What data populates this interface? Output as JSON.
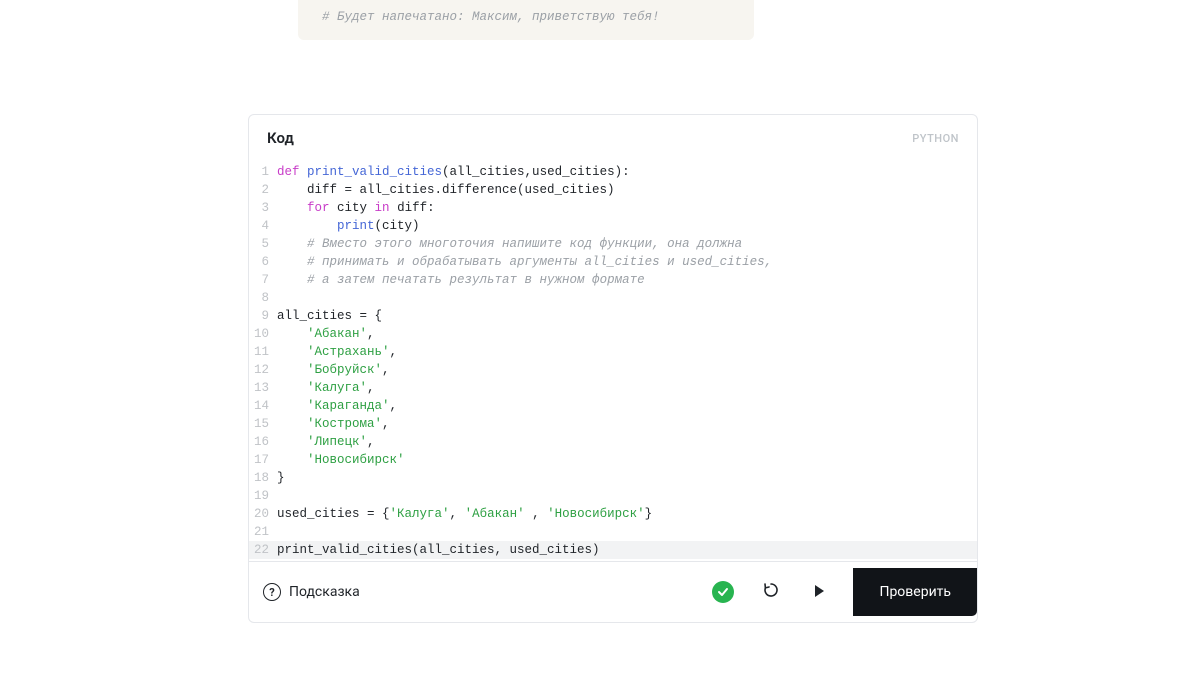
{
  "top_comment": "# Будет напечатано: Максим, приветствую тебя!",
  "editor": {
    "title": "Код",
    "language": "PYTHON",
    "lines": [
      {
        "n": 1,
        "hl": false,
        "tokens": [
          {
            "t": "def ",
            "c": "kw"
          },
          {
            "t": "print_valid_cities",
            "c": "fn"
          },
          {
            "t": "(all_cities,used_cities):",
            "c": ""
          }
        ]
      },
      {
        "n": 2,
        "hl": false,
        "tokens": [
          {
            "t": "    diff = all_cities.difference(used_cities)",
            "c": ""
          }
        ]
      },
      {
        "n": 3,
        "hl": false,
        "tokens": [
          {
            "t": "    ",
            "c": ""
          },
          {
            "t": "for",
            "c": "kw2"
          },
          {
            "t": " city ",
            "c": ""
          },
          {
            "t": "in",
            "c": "kw2"
          },
          {
            "t": " diff:",
            "c": ""
          }
        ]
      },
      {
        "n": 4,
        "hl": false,
        "tokens": [
          {
            "t": "        ",
            "c": ""
          },
          {
            "t": "print",
            "c": "fn"
          },
          {
            "t": "(city)",
            "c": ""
          }
        ]
      },
      {
        "n": 5,
        "hl": false,
        "tokens": [
          {
            "t": "    ",
            "c": ""
          },
          {
            "t": "# Вместо этого многоточия напишите код функции, она должна",
            "c": "cm"
          }
        ]
      },
      {
        "n": 6,
        "hl": false,
        "tokens": [
          {
            "t": "    ",
            "c": ""
          },
          {
            "t": "# принимать и обрабатывать аргументы all_cities и used_cities,",
            "c": "cm"
          }
        ]
      },
      {
        "n": 7,
        "hl": false,
        "tokens": [
          {
            "t": "    ",
            "c": ""
          },
          {
            "t": "# а затем печатать результат в нужном формате",
            "c": "cm"
          }
        ]
      },
      {
        "n": 8,
        "hl": false,
        "tokens": [
          {
            "t": "",
            "c": ""
          }
        ]
      },
      {
        "n": 9,
        "hl": false,
        "tokens": [
          {
            "t": "all_cities = {",
            "c": ""
          }
        ]
      },
      {
        "n": 10,
        "hl": false,
        "tokens": [
          {
            "t": "    ",
            "c": ""
          },
          {
            "t": "'Абакан'",
            "c": "str"
          },
          {
            "t": ",",
            "c": ""
          }
        ]
      },
      {
        "n": 11,
        "hl": false,
        "tokens": [
          {
            "t": "    ",
            "c": ""
          },
          {
            "t": "'Астрахань'",
            "c": "str"
          },
          {
            "t": ",",
            "c": ""
          }
        ]
      },
      {
        "n": 12,
        "hl": false,
        "tokens": [
          {
            "t": "    ",
            "c": ""
          },
          {
            "t": "'Бобруйск'",
            "c": "str"
          },
          {
            "t": ",",
            "c": ""
          }
        ]
      },
      {
        "n": 13,
        "hl": false,
        "tokens": [
          {
            "t": "    ",
            "c": ""
          },
          {
            "t": "'Калуга'",
            "c": "str"
          },
          {
            "t": ",",
            "c": ""
          }
        ]
      },
      {
        "n": 14,
        "hl": false,
        "tokens": [
          {
            "t": "    ",
            "c": ""
          },
          {
            "t": "'Караганда'",
            "c": "str"
          },
          {
            "t": ",",
            "c": ""
          }
        ]
      },
      {
        "n": 15,
        "hl": false,
        "tokens": [
          {
            "t": "    ",
            "c": ""
          },
          {
            "t": "'Кострома'",
            "c": "str"
          },
          {
            "t": ",",
            "c": ""
          }
        ]
      },
      {
        "n": 16,
        "hl": false,
        "tokens": [
          {
            "t": "    ",
            "c": ""
          },
          {
            "t": "'Липецк'",
            "c": "str"
          },
          {
            "t": ",",
            "c": ""
          }
        ]
      },
      {
        "n": 17,
        "hl": false,
        "tokens": [
          {
            "t": "    ",
            "c": ""
          },
          {
            "t": "'Новосибирск'",
            "c": "str"
          }
        ]
      },
      {
        "n": 18,
        "hl": false,
        "tokens": [
          {
            "t": "}",
            "c": ""
          }
        ]
      },
      {
        "n": 19,
        "hl": false,
        "tokens": [
          {
            "t": "",
            "c": ""
          }
        ]
      },
      {
        "n": 20,
        "hl": false,
        "tokens": [
          {
            "t": "used_cities = {",
            "c": ""
          },
          {
            "t": "'Калуга'",
            "c": "str"
          },
          {
            "t": ", ",
            "c": ""
          },
          {
            "t": "'Абакан'",
            "c": "str"
          },
          {
            "t": " , ",
            "c": ""
          },
          {
            "t": "'Новосибирск'",
            "c": "str"
          },
          {
            "t": "}",
            "c": ""
          }
        ]
      },
      {
        "n": 21,
        "hl": false,
        "tokens": [
          {
            "t": "",
            "c": ""
          }
        ]
      },
      {
        "n": 22,
        "hl": true,
        "tokens": [
          {
            "t": "print_valid_cities(all_cities, used_cities)",
            "c": ""
          }
        ]
      }
    ]
  },
  "toolbar": {
    "hint_label": "Подсказка",
    "check_label": "Проверить"
  }
}
